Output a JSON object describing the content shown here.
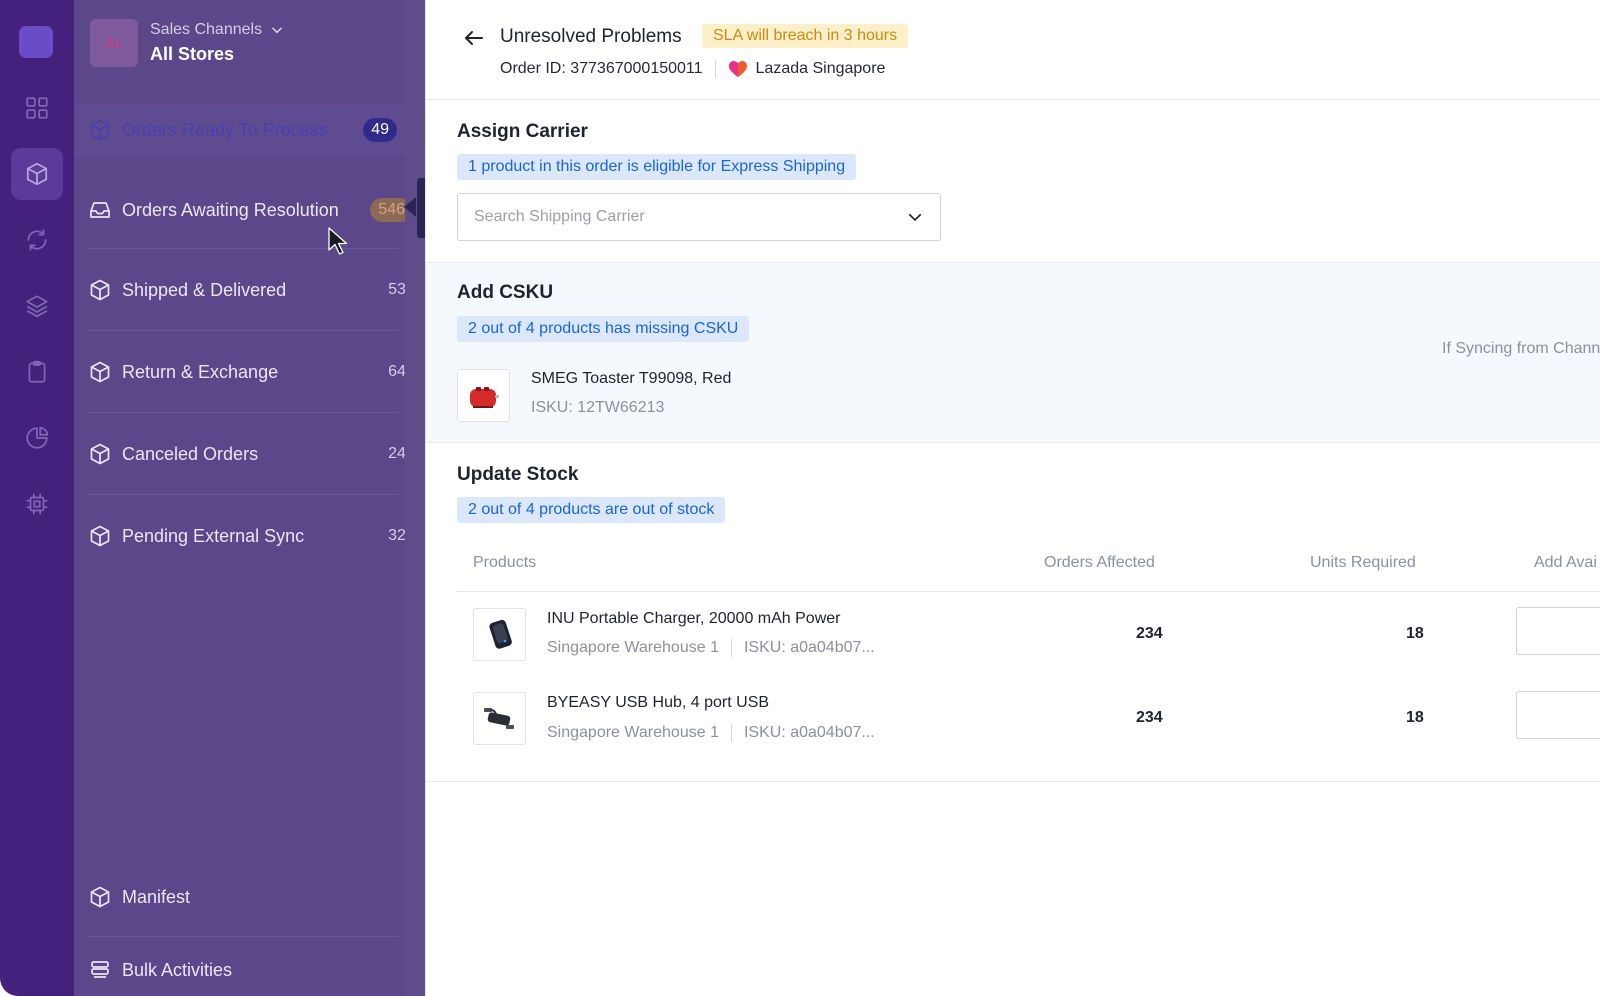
{
  "store": {
    "avatar": "AL",
    "channel_label": "Sales Channels",
    "name": "All Stores"
  },
  "sidebar": {
    "items": [
      {
        "label": "Orders Ready To Process",
        "count": "49"
      },
      {
        "label": "Orders Awaiting Resolution",
        "count": "546"
      },
      {
        "label": "Shipped & Delivered",
        "count": "53"
      },
      {
        "label": "Return & Exchange",
        "count": "64"
      },
      {
        "label": "Canceled Orders",
        "count": "24"
      },
      {
        "label": "Pending External Sync",
        "count": "32"
      }
    ],
    "footer_items": [
      {
        "label": "Manifest"
      },
      {
        "label": "Bulk Activities"
      }
    ]
  },
  "header": {
    "title": "Unresolved Problems",
    "sla_badge": "SLA will breach in 3 hours",
    "order_id": "Order ID: 377367000150011",
    "channel": "Lazada Singapore"
  },
  "assign_carrier": {
    "title": "Assign Carrier",
    "notice": "1 product in this order is eligible for Express Shipping",
    "search_placeholder": "Search Shipping Carrier"
  },
  "add_csku": {
    "title": "Add CSKU",
    "notice": "2 out of 4 products has missing CSKU",
    "sync_note": "If Syncing from Chann",
    "product": {
      "name": "SMEG Toaster T99098, Red",
      "isku": "ISKU: 12TW66213"
    }
  },
  "update_stock": {
    "title": "Update Stock",
    "notice": "2 out of 4 products are out of stock",
    "columns": [
      "Products",
      "Orders Affected",
      "Units Required",
      "Add Avai"
    ],
    "rows": [
      {
        "name": "INU Portable Charger, 20000 mAh Power",
        "warehouse": "Singapore Warehouse 1",
        "isku": "ISKU: a0a04b07...",
        "orders_affected": "234",
        "units_required": "18",
        "add_available": ""
      },
      {
        "name": "BYEASY USB Hub, 4 port USB",
        "warehouse": "Singapore Warehouse 1",
        "isku": "ISKU: a0a04b07...",
        "orders_affected": "234",
        "units_required": "18",
        "add_available": ""
      }
    ]
  },
  "colors": {
    "rail": "#44217c",
    "sidebar_overlay": "#5b4789",
    "active_badge": "#2f2a8c",
    "sla_bg": "#fdf0c9",
    "sla_text": "#c98b12",
    "notice_bg": "#dbe8fb",
    "notice_text": "#1a64d6"
  },
  "icons": {
    "rail": [
      "dashboard-grid-icon",
      "box-icon",
      "sync-icon",
      "layers-icon",
      "clipboard-icon",
      "pie-chart-icon",
      "chip-icon"
    ],
    "back": "arrow-left-icon",
    "channel": "lazada-heart-icon"
  }
}
